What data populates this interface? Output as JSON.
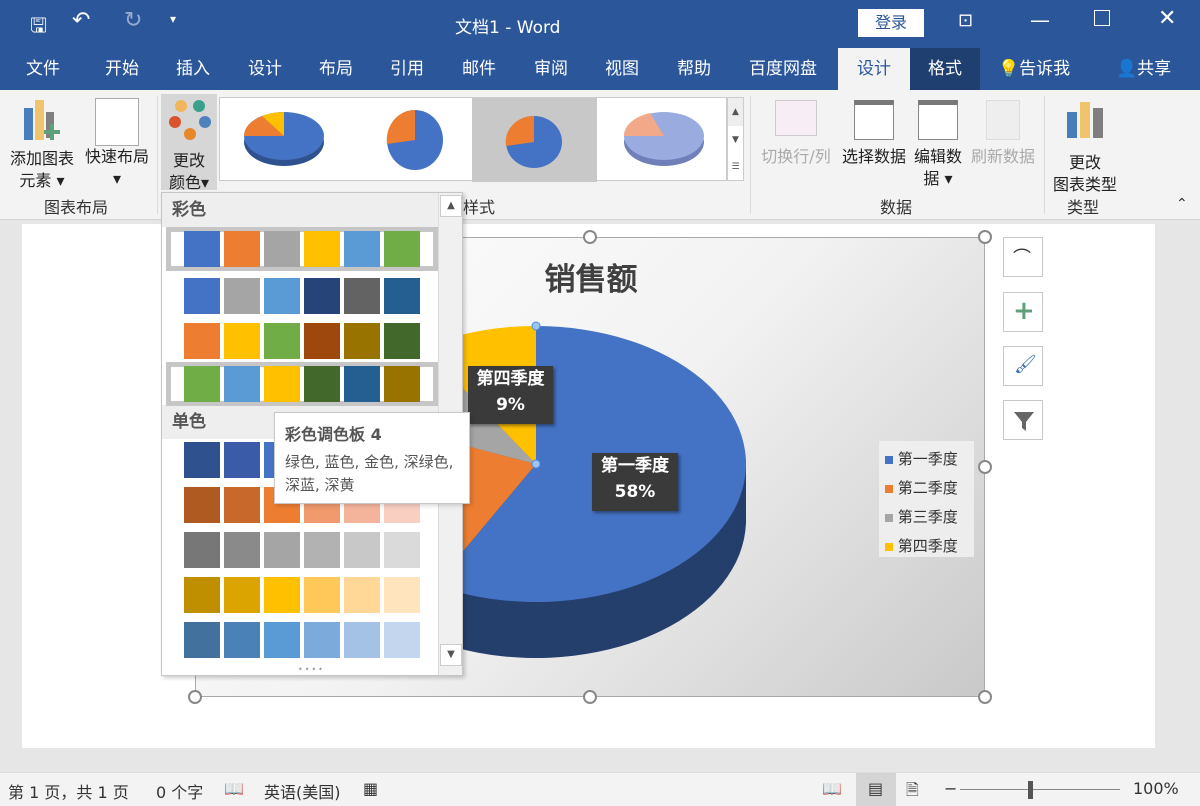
{
  "titlebar": {
    "title": "文档1  -  Word",
    "login": "登录",
    "save_icon": "save-icon",
    "undo_icon": "undo-icon",
    "redo_icon": "redo-icon"
  },
  "tabs": [
    "文件",
    "开始",
    "插入",
    "设计",
    "布局",
    "引用",
    "邮件",
    "审阅",
    "视图",
    "帮助",
    "百度网盘",
    "设计",
    "格式"
  ],
  "tell_me": "告诉我",
  "share": "共享",
  "ribbon": {
    "add_element": [
      "添加图表",
      "元素"
    ],
    "quick_layout": "快速布局",
    "change_color": [
      "更改",
      "颜色"
    ],
    "group_layout": "图表布局",
    "group_style_partial": "样式",
    "switch_row_col": "切换行/列",
    "select_data": "选择数据",
    "edit_data": [
      "编辑数",
      "据"
    ],
    "refresh_data": "刷新数据",
    "group_data": "数据",
    "change_type": [
      "更改",
      "图表类型"
    ],
    "group_type": "类型"
  },
  "dropdown": {
    "section_colorful": "彩色",
    "section_mono": "单色",
    "colorful_rows": [
      {
        "selected": true,
        "colors": [
          "#4472c4",
          "#ed7d31",
          "#a5a5a5",
          "#ffc000",
          "#5b9bd5",
          "#70ad47"
        ]
      },
      {
        "selected": false,
        "colors": [
          "#4472c4",
          "#a5a5a5",
          "#5b9bd5",
          "#264478",
          "#636363",
          "#255e91"
        ]
      },
      {
        "selected": false,
        "colors": [
          "#ed7d31",
          "#ffc000",
          "#70ad47",
          "#9e480e",
          "#997300",
          "#43682b"
        ]
      },
      {
        "selected": true,
        "colors": [
          "#70ad47",
          "#5b9bd5",
          "#ffc000",
          "#43682b",
          "#255e91",
          "#997300"
        ]
      }
    ],
    "mono_rows": [
      [
        "#2f528f",
        "#3a5ca8",
        "#4472c4",
        "#6f8fd0",
        "#9fb3e0",
        "#c9d4ee"
      ],
      [
        "#ae5a21",
        "#c9682b",
        "#ed7d31",
        "#f19a6e",
        "#f4b49c",
        "#f8cfc1"
      ],
      [
        "#777777",
        "#8a8a8a",
        "#a5a5a5",
        "#b2b2b2",
        "#c8c8c8",
        "#dadada"
      ],
      [
        "#bf8f00",
        "#dba400",
        "#ffc000",
        "#ffc859",
        "#ffd796",
        "#ffe4bd"
      ],
      [
        "#41719c",
        "#4a82b7",
        "#5b9bd5",
        "#7cabdb",
        "#a3c2e6",
        "#c4d6ed"
      ]
    ]
  },
  "tooltip": {
    "title": "彩色调色板 4",
    "desc": "绿色, 蓝色, 金色, 深绿色, 深蓝, 深黄"
  },
  "chart_data": {
    "type": "pie",
    "title": "销售额",
    "categories": [
      "第一季度",
      "第二季度",
      "第三季度",
      "第四季度"
    ],
    "values": [
      58,
      23,
      10,
      9
    ],
    "colors": [
      "#4472c4",
      "#ed7d31",
      "#a5a5a5",
      "#ffc000"
    ],
    "data_labels": [
      {
        "cat": "第一季度",
        "pct": "58%"
      },
      {
        "cat": "第四季度",
        "pct": "9%"
      }
    ],
    "legend": "right"
  },
  "status": {
    "page": "第 1 页，共 1 页",
    "words": "0 个字",
    "lang": "英语(美国)",
    "zoom": "100%"
  }
}
